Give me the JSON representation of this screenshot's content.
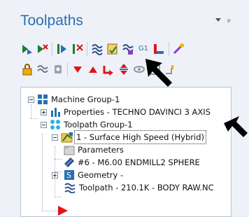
{
  "panel": {
    "title": "Toolpaths",
    "menu_icon": "chevron-down-icon",
    "pin_icon": "pin-icon",
    "pin_glyph": "ᵖ"
  },
  "toolbar": {
    "row1_icons": [
      "select-all-operations-icon",
      "deselect-all-operations-icon",
      "regenerate-selected-icon",
      "regenerate-dirty-icon",
      "backplot-selected-icon",
      "verify-selected-icon",
      "simulate-icon",
      "post-selected-icon",
      "toggle-display-icon",
      "help-icon"
    ],
    "g1_label": "G1",
    "row2_icons": [
      "lock-icon",
      "toggle-posting-icon",
      "tool-display-icon",
      "move-down-icon",
      "move-up-icon",
      "insert-arrow-icon",
      "scroll-icon",
      "hide-icon",
      "expand-icon",
      "collapse-icon"
    ]
  },
  "tree": {
    "machine_group": "Machine Group-1",
    "properties": "Properties - TECHNO DAVINCI 3 AXIS",
    "toolpath_group": "Toolpath Group-1",
    "operation": "1 - Surface High Speed (Hybrid)",
    "parameters": "Parameters",
    "tool": "#6 - M6.00 ENDMILL2 SPHERE",
    "geometry": "Geometry -",
    "toolpath": "Toolpath - 210.1K - BODY RAW.NC"
  },
  "colors": {
    "title": "#2a6fb3",
    "insert_arrow": "#e0141b",
    "selection": "#cce4ff"
  }
}
